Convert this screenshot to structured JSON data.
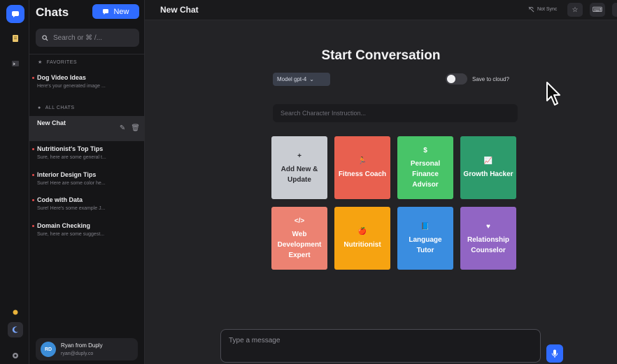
{
  "colors": {
    "accent": "#2f6bff",
    "unread_dot": "#e04b4b",
    "cards": [
      "#c9ccd2",
      "#e8604f",
      "#48c468",
      "#2d9b6c",
      "#ec8272",
      "#f6a311",
      "#3a8de0",
      "#9165c4"
    ]
  },
  "sidebar": {
    "title": "Chats",
    "new_label": "New",
    "search_placeholder": "Search or ⌘ /...",
    "favorites_label": "FAVORITES",
    "all_chats_label": "ALL CHATS",
    "favorites": [
      {
        "title": "Dog Video Ideas",
        "snippet": "Here's your generated image ..."
      }
    ],
    "chats": [
      {
        "title": "New Chat",
        "snippet": "",
        "active": true
      },
      {
        "title": "Nutritionist's Top Tips",
        "snippet": "Sure, here are some general t..."
      },
      {
        "title": "Interior Design Tips",
        "snippet": "Sure! Here are some color he..."
      },
      {
        "title": "Code with Data",
        "snippet": "Sure! Here's some example J..."
      },
      {
        "title": "Domain Checking",
        "snippet": "Sure, here are some suggest..."
      }
    ],
    "user": {
      "initials": "RD",
      "name": "Ryan from Duply",
      "email": "ryan@duply.co"
    }
  },
  "topbar": {
    "title": "New Chat",
    "sync_label": "Not Sync"
  },
  "main": {
    "heading": "Start Conversation",
    "model_label": "Model gpt-4",
    "save_label": "Save to cloud?",
    "save_enabled": false,
    "character_search_placeholder": "Search Character Instruction...",
    "composer_placeholder": "Type a message"
  },
  "characters": [
    {
      "icon": "plus-icon",
      "glyph": "+",
      "label": "Add New & Update"
    },
    {
      "icon": "runner-icon",
      "glyph": "🏃",
      "label": "Fitness Coach"
    },
    {
      "icon": "dollar-icon",
      "glyph": "$",
      "label": "Personal Finance Advisor"
    },
    {
      "icon": "chart-icon",
      "glyph": "📈",
      "label": "Growth Hacker"
    },
    {
      "icon": "code-icon",
      "glyph": "</>",
      "label": "Web Development Expert"
    },
    {
      "icon": "apple-icon",
      "glyph": "🍎",
      "label": "Nutritionist"
    },
    {
      "icon": "book-icon",
      "glyph": "📘",
      "label": "Language Tutor"
    },
    {
      "icon": "heart-icon",
      "glyph": "♥",
      "label": "Relationship Counselor"
    }
  ]
}
